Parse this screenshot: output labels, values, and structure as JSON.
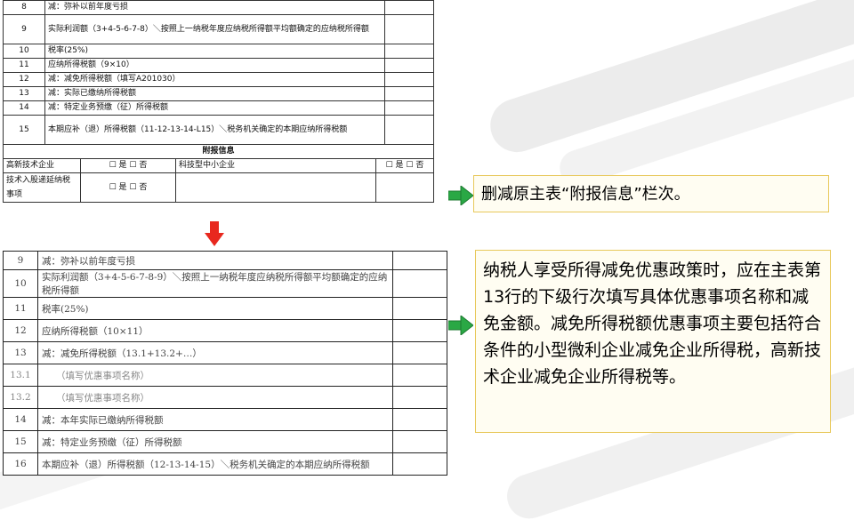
{
  "top_table": {
    "rows": [
      {
        "no": "8",
        "text": "减：弥补以前年度亏损"
      },
      {
        "no": "9",
        "text": "实际利润额（3+4-5-6-7-8）＼按照上一纳税年度应纳税所得额平均额确定的应纳税所得额"
      },
      {
        "no": "10",
        "text": "税率(25%)"
      },
      {
        "no": "11",
        "text": "应纳所得税额（9×10）"
      },
      {
        "no": "12",
        "text": "减：减免所得税额（填写A201030）"
      },
      {
        "no": "13",
        "text": "减：实际已缴纳所得税额"
      },
      {
        "no": "14",
        "text": "减：特定业务预缴（征）所得税额"
      },
      {
        "no": "15",
        "text": "本期应补（退）所得税额（11-12-13-14-L15）＼税务机关确定的本期应纳所得税额"
      }
    ],
    "appendix_header": "附报信息",
    "appendix_row1": {
      "label1": "高新技术企业",
      "check1": "☐ 是 ☐ 否",
      "label2": "科技型中小企业",
      "check2": "☐ 是 ☐ 否"
    },
    "appendix_row2": {
      "label1": "技术入股递延纳税事项",
      "check1": "☐ 是 ☐ 否"
    }
  },
  "bottom_table": {
    "rows": [
      {
        "no": "9",
        "text": "减：弥补以前年度亏损",
        "sub": false
      },
      {
        "no": "10",
        "text": "实际利润额（3+4-5-6-7-8-9）＼按照上一纳税年度应纳税所得额平均额确定的应纳税所得额",
        "sub": false
      },
      {
        "no": "11",
        "text": "税率(25%)",
        "sub": false
      },
      {
        "no": "12",
        "text": "应纳所得税额（10×11）",
        "sub": false
      },
      {
        "no": "13",
        "text": "减：减免所得税额（13.1+13.2+…）",
        "sub": false
      },
      {
        "no": "13.1",
        "text": "（填写优惠事项名称）",
        "sub": true
      },
      {
        "no": "13.2",
        "text": "（填写优惠事项名称）",
        "sub": true
      },
      {
        "no": "14",
        "text": "减：本年实际已缴纳所得税额",
        "sub": false
      },
      {
        "no": "15",
        "text": "减：特定业务预缴（征）所得税额",
        "sub": false
      },
      {
        "no": "16",
        "text": "本期应补（退）所得税额（12-13-14-15）＼税务机关确定的本期应纳所得税额",
        "sub": false
      }
    ]
  },
  "notes": {
    "note1": "删减原主表“附报信息”栏次。",
    "note2": "纳税人享受所得减免优惠政策时，应在主表第13行的下级行次填写具体优惠事项名称和减免金额。减免所得税额优惠事项主要包括符合条件的小型微利企业减免企业所得税，高新技术企业减免企业所得税等。"
  },
  "colors": {
    "arrow_green": "#2aa845",
    "arrow_red": "#e8281e",
    "note_border": "#e8c85a"
  }
}
